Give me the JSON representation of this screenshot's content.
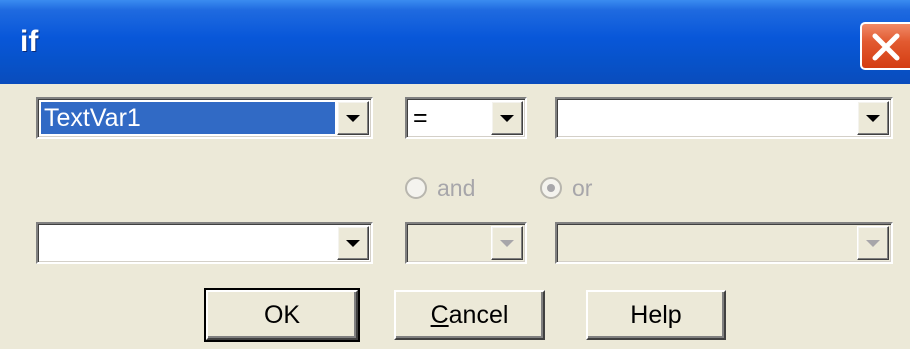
{
  "window": {
    "title": "if"
  },
  "row1": {
    "variable": "TextVar1",
    "operator": "=",
    "value": ""
  },
  "logic": {
    "and_label": "and",
    "or_label": "or",
    "selected": "or",
    "enabled": false
  },
  "row2": {
    "variable": "",
    "operator": "",
    "value": ""
  },
  "buttons": {
    "ok": "OK",
    "cancel_mnemonic": "C",
    "cancel_rest": "ancel",
    "help": "Help"
  },
  "colors": {
    "titlebar": "#0752c9",
    "selection": "#316ac5",
    "dialog_bg": "#ece9d8",
    "disabled_text": "#a7a6aa",
    "close_button": "#d43d12"
  },
  "icons": {
    "close": "close-icon",
    "dropdown": "chevron-down-icon"
  }
}
